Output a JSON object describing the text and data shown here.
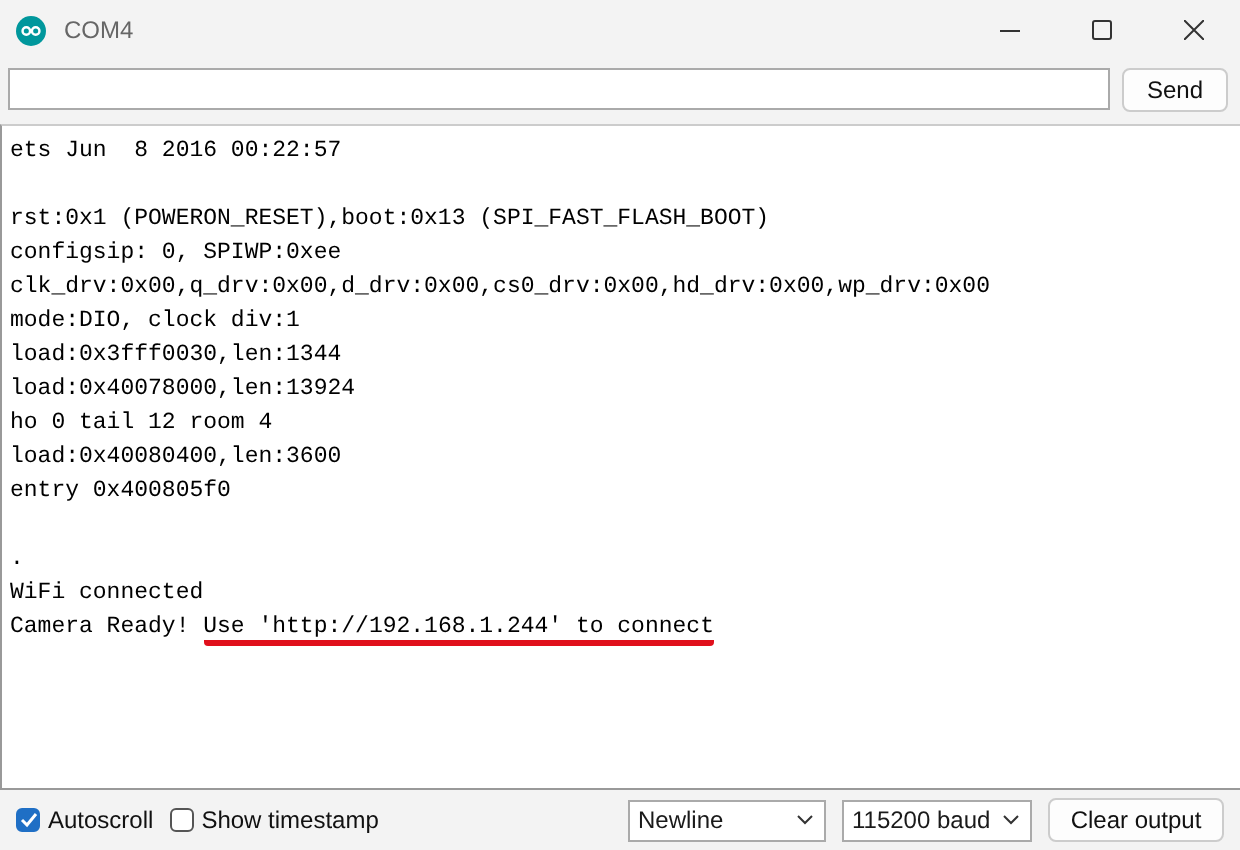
{
  "window": {
    "title": "COM4"
  },
  "send_button": "Send",
  "output": [
    {
      "segments": [
        {
          "text": "ets Jun  8 2016 00:22:57",
          "underlined": false
        }
      ]
    },
    {
      "kind": "blank"
    },
    {
      "segments": [
        {
          "text": "rst:0x1 (POWERON_RESET),boot:0x13 (SPI_FAST_FLASH_BOOT)",
          "underlined": false
        }
      ]
    },
    {
      "segments": [
        {
          "text": "configsip: 0, SPIWP:0xee",
          "underlined": false
        }
      ]
    },
    {
      "segments": [
        {
          "text": "clk_drv:0x00,q_drv:0x00,d_drv:0x00,cs0_drv:0x00,hd_drv:0x00,wp_drv:0x00",
          "underlined": false
        }
      ]
    },
    {
      "segments": [
        {
          "text": "mode:DIO, clock div:1",
          "underlined": false
        }
      ]
    },
    {
      "segments": [
        {
          "text": "load:0x3fff0030,len:1344",
          "underlined": false
        }
      ]
    },
    {
      "segments": [
        {
          "text": "load:0x40078000,len:13924",
          "underlined": false
        }
      ]
    },
    {
      "segments": [
        {
          "text": "ho 0 tail 12 room 4",
          "underlined": false
        }
      ]
    },
    {
      "segments": [
        {
          "text": "load:0x40080400,len:3600",
          "underlined": false
        }
      ]
    },
    {
      "segments": [
        {
          "text": "entry 0x400805f0",
          "underlined": false
        }
      ]
    },
    {
      "kind": "blank"
    },
    {
      "segments": [
        {
          "text": ".",
          "underlined": false
        }
      ]
    },
    {
      "segments": [
        {
          "text": "WiFi connected",
          "underlined": false
        }
      ]
    },
    {
      "segments": [
        {
          "text": "Camera Ready! ",
          "underlined": false
        },
        {
          "text": "Use 'http://192.168.1.244' to connect",
          "underlined": true
        }
      ]
    }
  ],
  "autoscroll": {
    "label": "Autoscroll",
    "checked": true
  },
  "show_timestamp": {
    "label": "Show timestamp",
    "checked": false
  },
  "line_ending": {
    "value": "Newline"
  },
  "baud_rate": {
    "value": "115200 baud"
  },
  "clear_button": "Clear output"
}
